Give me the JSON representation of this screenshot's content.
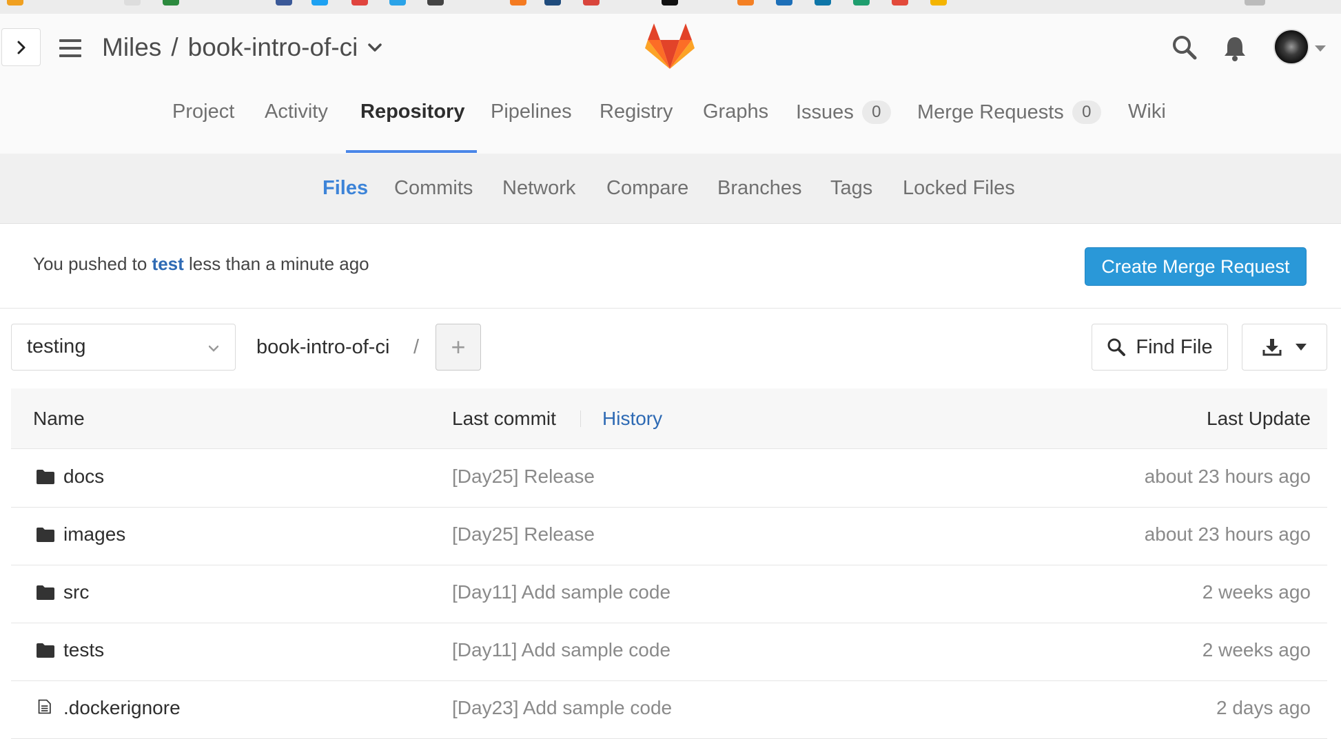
{
  "header": {
    "breadcrumb_owner": "Miles",
    "breadcrumb_separator": "/",
    "breadcrumb_project": "book-intro-of-ci"
  },
  "main_nav": {
    "items": [
      {
        "label": "Project"
      },
      {
        "label": "Activity"
      },
      {
        "label": "Repository",
        "active": true
      },
      {
        "label": "Pipelines"
      },
      {
        "label": "Registry"
      },
      {
        "label": "Graphs"
      },
      {
        "label": "Issues",
        "count": "0"
      },
      {
        "label": "Merge Requests",
        "count": "0"
      },
      {
        "label": "Wiki"
      }
    ]
  },
  "sub_nav": {
    "items": [
      {
        "label": "Files",
        "active": true
      },
      {
        "label": "Commits"
      },
      {
        "label": "Network"
      },
      {
        "label": "Compare"
      },
      {
        "label": "Branches"
      },
      {
        "label": "Tags"
      },
      {
        "label": "Locked Files"
      }
    ]
  },
  "push_notice": {
    "prefix": "You pushed to",
    "branch": "test",
    "suffix": "less than a minute ago",
    "button": "Create Merge Request"
  },
  "tree": {
    "branch": "testing",
    "path": "book-intro-of-ci",
    "path_separator": "/",
    "add_symbol": "+",
    "find_file": "Find File"
  },
  "table": {
    "headers": {
      "name": "Name",
      "last_commit": "Last commit",
      "history": "History",
      "last_update": "Last Update"
    },
    "rows": [
      {
        "type": "folder",
        "name": "docs",
        "commit": "[Day25] Release",
        "updated": "about 23 hours ago"
      },
      {
        "type": "folder",
        "name": "images",
        "commit": "[Day25] Release",
        "updated": "about 23 hours ago"
      },
      {
        "type": "folder",
        "name": "src",
        "commit": "[Day11] Add sample code",
        "updated": "2 weeks ago"
      },
      {
        "type": "folder",
        "name": "tests",
        "commit": "[Day11] Add sample code",
        "updated": "2 weeks ago"
      },
      {
        "type": "file",
        "name": ".dockerignore",
        "commit": "[Day23] Add sample code",
        "updated": "2 days ago"
      }
    ]
  },
  "colors": {
    "accent_blue": "#3d84d8",
    "link_blue": "#2e6ab4",
    "button_blue": "#2a98d8",
    "logo_orange": "#fc6d26",
    "logo_red": "#e24329"
  },
  "icons": [
    "chevron-right-icon",
    "hamburger-icon",
    "gitlab-logo",
    "search-icon",
    "bell-icon",
    "chevron-down-icon",
    "folder-icon",
    "file-icon",
    "download-icon",
    "caret-down-icon"
  ]
}
